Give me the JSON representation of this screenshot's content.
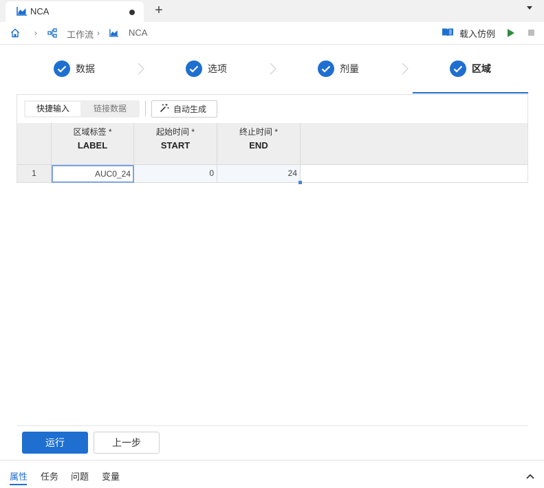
{
  "tabbar": {
    "tab_title": "NCA",
    "tab_icon": "area-chart-icon",
    "new_tab": "+"
  },
  "breadcrumb": {
    "sep": "›",
    "workflow": "工作流",
    "nca": "NCA",
    "load_example": "载入仿例"
  },
  "steps": [
    {
      "label": "数据",
      "done": true
    },
    {
      "label": "选项",
      "done": true
    },
    {
      "label": "剂量",
      "done": true
    },
    {
      "label": "区域",
      "done": true,
      "active": true
    }
  ],
  "toolbar": {
    "quick_input": "快捷输入",
    "link_data": "链接数据",
    "auto_generate": "自动生成"
  },
  "table": {
    "columns": [
      {
        "cn": "区域标签 *",
        "en": "LABEL"
      },
      {
        "cn": "起始时间 *",
        "en": "START"
      },
      {
        "cn": "终止时间 *",
        "en": "END"
      }
    ],
    "rows": [
      {
        "num": "1",
        "label": "AUC0_24",
        "start": "0",
        "end": "24"
      }
    ]
  },
  "footer": {
    "run": "运行",
    "prev": "上一步"
  },
  "bottom_tabs": [
    "属性",
    "任务",
    "问题",
    "变量"
  ],
  "colors": {
    "accent": "#1e6fd0",
    "run_green": "#2e8b3e"
  }
}
